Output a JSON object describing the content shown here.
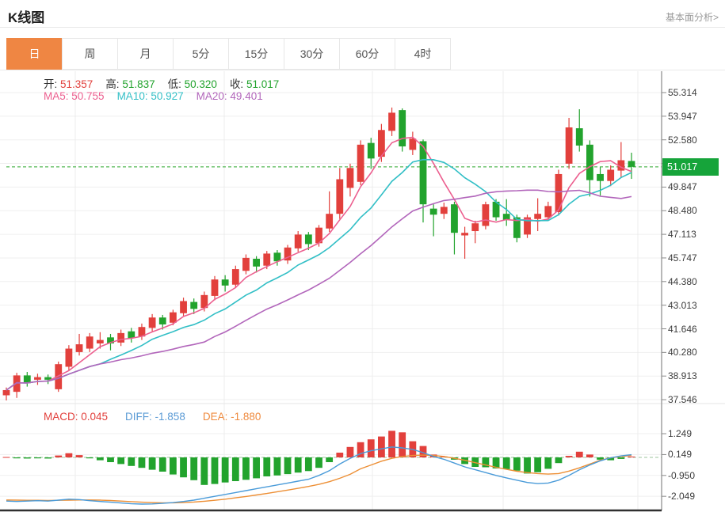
{
  "header": {
    "title": "K线图",
    "link": "基本面分析>"
  },
  "tabs": {
    "items": [
      {
        "label": "日",
        "active": true
      },
      {
        "label": "周",
        "active": false
      },
      {
        "label": "月",
        "active": false
      },
      {
        "label": "5分",
        "active": false
      },
      {
        "label": "15分",
        "active": false
      },
      {
        "label": "30分",
        "active": false
      },
      {
        "label": "60分",
        "active": false
      },
      {
        "label": "4时",
        "active": false
      }
    ]
  },
  "legend": {
    "ohlc": [
      {
        "label": "开:",
        "value": "51.357",
        "color": "#e2403c"
      },
      {
        "label": "高:",
        "value": "51.837",
        "color": "#22a32d"
      },
      {
        "label": "低:",
        "value": "50.320",
        "color": "#22a32d"
      },
      {
        "label": "收:",
        "value": "51.017",
        "color": "#22a32d"
      }
    ],
    "ma": [
      {
        "label": "MA5:",
        "value": "50.755",
        "color": "#ec5f8f"
      },
      {
        "label": "MA10:",
        "value": "50.927",
        "color": "#32bfc6"
      },
      {
        "label": "MA20:",
        "value": "49.401",
        "color": "#b266bb"
      }
    ],
    "macd": [
      {
        "label": "MACD:",
        "value": "0.045",
        "color": "#e2403c"
      },
      {
        "label": "DIFF:",
        "value": "-1.858",
        "color": "#5b9bd5"
      },
      {
        "label": "DEA:",
        "value": "-1.880",
        "color": "#ef8b3f"
      }
    ]
  },
  "price_tag": {
    "value": "51.017",
    "bg": "#16a43a"
  },
  "colors": {
    "up": "#e2403c",
    "down": "#22a32d",
    "ma5": "#ec5f8f",
    "ma10": "#32bfc6",
    "ma20": "#b266bb",
    "diff": "#4a9bd9",
    "dea": "#ed8f35",
    "price_line": "#2aa62a",
    "grid": "#efefef",
    "vgrid": "#ececec",
    "axis": "#8a8a8a",
    "bottom_border": "#2f2f2f",
    "zero_dash": "#9ec49e"
  },
  "chart_data": [
    {
      "type": "candlestick",
      "title": "K线图",
      "timeframe": "日",
      "legend_values": {
        "open": 51.357,
        "high": 51.837,
        "low": 50.32,
        "close": 51.017,
        "ma5": 50.755,
        "ma10": 50.927,
        "ma20": 49.401
      },
      "ma_periods": [
        5,
        10,
        20
      ],
      "current_price": 51.017,
      "ylim": [
        37.546,
        55.314
      ],
      "y_ticks": [
        "55.314",
        "53.947",
        "52.580",
        "51.214",
        "49.847",
        "48.480",
        "47.113",
        "45.747",
        "44.380",
        "43.013",
        "41.646",
        "40.280",
        "38.913",
        "37.546"
      ],
      "grid": true,
      "ohlc_order": "open,high,low,close",
      "candles": [
        [
          37.8,
          38.25,
          37.5,
          38.1
        ],
        [
          38.0,
          39.1,
          37.65,
          38.95
        ],
        [
          38.95,
          39.15,
          38.3,
          38.5
        ],
        [
          38.7,
          39.05,
          38.4,
          38.85
        ],
        [
          38.85,
          39.0,
          38.45,
          38.7
        ],
        [
          38.15,
          39.75,
          38.0,
          39.6
        ],
        [
          39.45,
          40.7,
          39.2,
          40.5
        ],
        [
          40.3,
          41.35,
          40.1,
          40.75
        ],
        [
          40.5,
          41.4,
          40.3,
          41.2
        ],
        [
          40.8,
          41.45,
          40.5,
          41.0
        ],
        [
          41.15,
          41.35,
          40.4,
          40.8
        ],
        [
          40.85,
          41.6,
          40.65,
          41.4
        ],
        [
          41.5,
          41.7,
          40.85,
          41.1
        ],
        [
          41.2,
          41.95,
          41.0,
          41.75
        ],
        [
          41.7,
          42.5,
          41.5,
          42.3
        ],
        [
          42.3,
          42.45,
          41.6,
          41.9
        ],
        [
          42.0,
          42.75,
          41.85,
          42.6
        ],
        [
          42.55,
          43.45,
          42.4,
          43.25
        ],
        [
          43.2,
          43.4,
          42.5,
          42.8
        ],
        [
          42.85,
          43.8,
          42.65,
          43.6
        ],
        [
          43.55,
          44.7,
          43.3,
          44.5
        ],
        [
          44.5,
          44.75,
          43.8,
          44.15
        ],
        [
          44.2,
          45.3,
          44.0,
          45.1
        ],
        [
          45.0,
          45.95,
          44.8,
          45.75
        ],
        [
          45.7,
          45.85,
          44.9,
          45.25
        ],
        [
          45.3,
          46.15,
          45.1,
          46.0
        ],
        [
          46.05,
          46.2,
          45.3,
          45.55
        ],
        [
          45.6,
          46.5,
          45.4,
          46.35
        ],
        [
          46.3,
          47.3,
          46.1,
          47.1
        ],
        [
          47.1,
          47.25,
          46.2,
          46.55
        ],
        [
          46.6,
          47.65,
          46.4,
          47.5
        ],
        [
          47.45,
          49.6,
          47.25,
          48.3
        ],
        [
          48.3,
          50.95,
          48.0,
          50.3
        ],
        [
          49.8,
          51.2,
          49.3,
          50.95
        ],
        [
          50.15,
          52.55,
          49.95,
          52.3
        ],
        [
          52.4,
          52.7,
          50.9,
          51.5
        ],
        [
          51.6,
          53.5,
          51.3,
          53.15
        ],
        [
          53.1,
          54.45,
          52.8,
          54.15
        ],
        [
          54.3,
          54.4,
          51.9,
          52.2
        ],
        [
          52.0,
          53.05,
          51.7,
          52.65
        ],
        [
          52.5,
          52.6,
          47.8,
          48.85
        ],
        [
          48.6,
          48.85,
          47.0,
          48.25
        ],
        [
          48.3,
          48.95,
          48.0,
          48.7
        ],
        [
          48.85,
          49.0,
          45.95,
          47.2
        ],
        [
          47.05,
          47.55,
          45.7,
          47.2
        ],
        [
          47.3,
          47.9,
          46.6,
          47.75
        ],
        [
          47.6,
          49.0,
          47.4,
          48.85
        ],
        [
          49.0,
          49.15,
          47.9,
          48.1
        ],
        [
          48.3,
          49.15,
          47.6,
          47.95
        ],
        [
          48.1,
          48.25,
          46.65,
          46.9
        ],
        [
          47.1,
          48.25,
          46.9,
          48.1
        ],
        [
          48.0,
          49.2,
          47.3,
          48.3
        ],
        [
          48.1,
          49.0,
          47.9,
          48.75
        ],
        [
          48.4,
          50.85,
          48.2,
          50.6
        ],
        [
          51.2,
          53.85,
          50.9,
          53.3
        ],
        [
          53.25,
          54.35,
          51.9,
          52.25
        ],
        [
          52.3,
          52.55,
          49.3,
          50.25
        ],
        [
          50.6,
          51.0,
          49.35,
          50.2
        ],
        [
          50.2,
          51.1,
          49.9,
          50.85
        ],
        [
          50.8,
          52.45,
          50.4,
          51.4
        ],
        [
          51.357,
          51.837,
          50.32,
          51.017
        ]
      ]
    },
    {
      "type": "bar",
      "title": "MACD",
      "legend_values": {
        "macd": 0.045,
        "diff": -1.858,
        "dea": -1.88
      },
      "y_ticks": [
        "1.249",
        "0.149",
        "-0.950",
        "-2.049"
      ],
      "hist": [
        0.02,
        -0.05,
        -0.06,
        -0.05,
        -0.06,
        0.1,
        0.22,
        0.12,
        -0.05,
        -0.15,
        -0.25,
        -0.35,
        -0.45,
        -0.55,
        -0.65,
        -0.75,
        -0.9,
        -1.05,
        -1.2,
        -1.45,
        -1.4,
        -1.32,
        -1.25,
        -1.18,
        -1.1,
        -1.0,
        -0.95,
        -0.88,
        -0.8,
        -0.72,
        -0.55,
        -0.25,
        0.25,
        0.55,
        0.8,
        0.95,
        1.1,
        1.4,
        1.32,
        0.85,
        0.6,
        0.15,
        0.05,
        -0.12,
        -0.35,
        -0.5,
        -0.52,
        -0.58,
        -0.62,
        -0.7,
        -0.85,
        -0.78,
        -0.6,
        -0.3,
        0.08,
        0.3,
        0.15,
        -0.12,
        -0.15,
        -0.08,
        0.045
      ],
      "diff": [
        -2.3,
        -2.32,
        -2.3,
        -2.28,
        -2.3,
        -2.25,
        -2.2,
        -2.22,
        -2.28,
        -2.32,
        -2.36,
        -2.4,
        -2.44,
        -2.46,
        -2.45,
        -2.42,
        -2.38,
        -2.32,
        -2.25,
        -2.15,
        -2.05,
        -1.95,
        -1.85,
        -1.75,
        -1.65,
        -1.55,
        -1.45,
        -1.35,
        -1.25,
        -1.15,
        -0.95,
        -0.7,
        -0.35,
        -0.05,
        0.2,
        0.35,
        0.45,
        0.55,
        0.5,
        0.42,
        0.25,
        0.05,
        -0.1,
        -0.3,
        -0.5,
        -0.65,
        -0.8,
        -0.95,
        -1.08,
        -1.2,
        -1.32,
        -1.38,
        -1.35,
        -1.2,
        -0.95,
        -0.65,
        -0.4,
        -0.18,
        -0.02,
        0.08,
        0.14
      ],
      "dea": [
        -2.24,
        -2.25,
        -2.26,
        -2.26,
        -2.27,
        -2.26,
        -2.25,
        -2.24,
        -2.24,
        -2.25,
        -2.27,
        -2.3,
        -2.33,
        -2.36,
        -2.38,
        -2.39,
        -2.39,
        -2.38,
        -2.35,
        -2.31,
        -2.26,
        -2.2,
        -2.13,
        -2.06,
        -1.98,
        -1.9,
        -1.81,
        -1.72,
        -1.63,
        -1.53,
        -1.42,
        -1.28,
        -1.1,
        -0.89,
        -0.6,
        -0.4,
        -0.2,
        -0.05,
        0.05,
        0.1,
        0.12,
        0.1,
        0.05,
        -0.05,
        -0.15,
        -0.28,
        -0.4,
        -0.52,
        -0.63,
        -0.73,
        -0.8,
        -0.85,
        -0.88,
        -0.85,
        -0.72,
        -0.55,
        -0.35,
        -0.15,
        -0.02,
        0.05,
        0.1
      ]
    }
  ]
}
